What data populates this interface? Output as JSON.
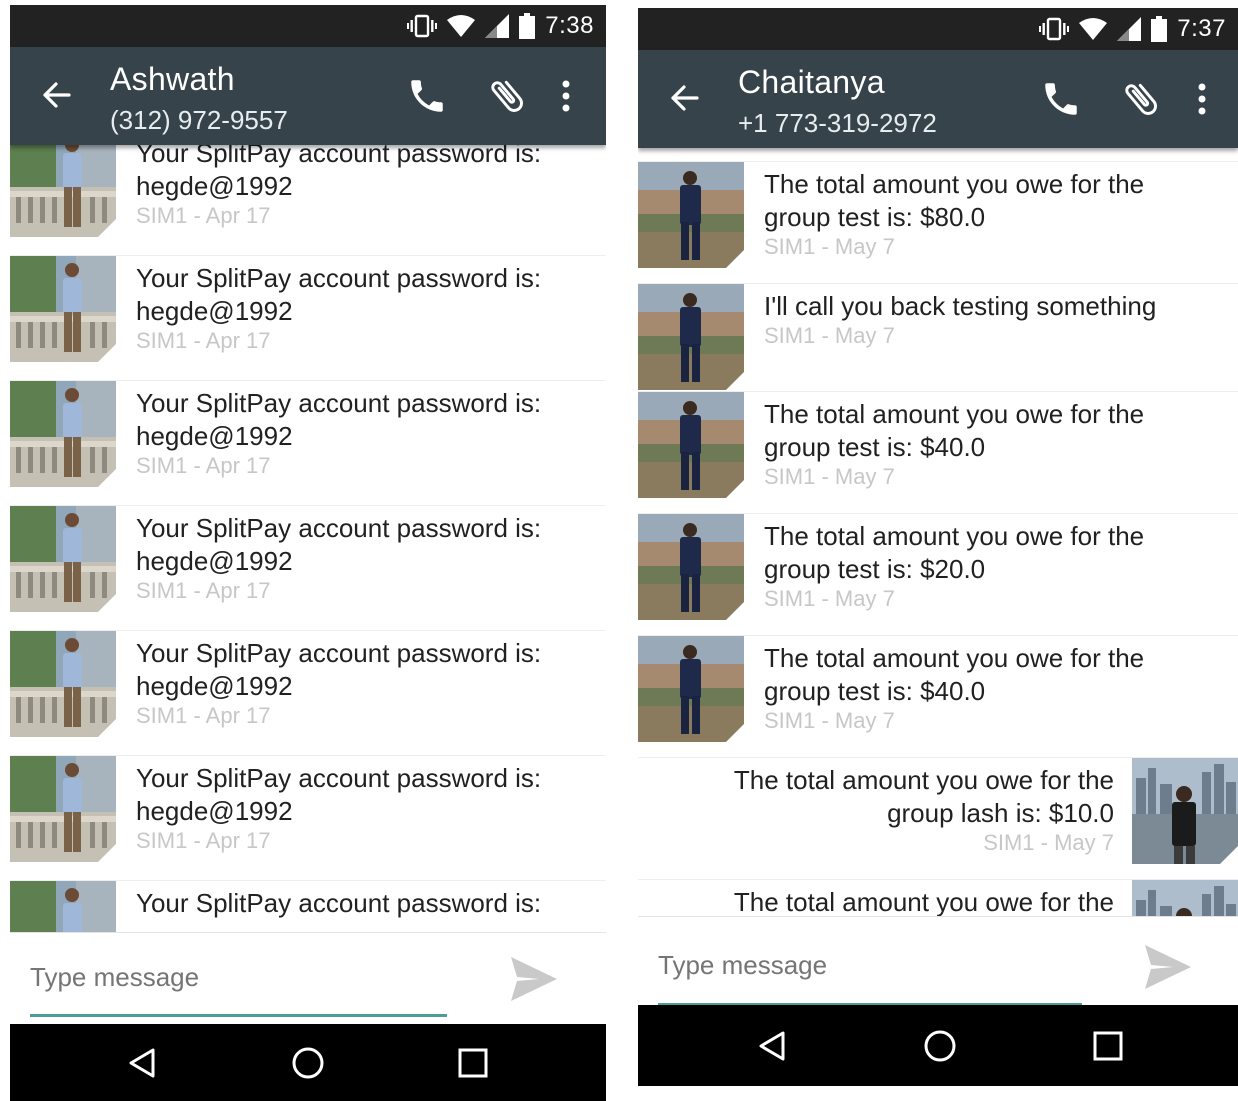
{
  "left": {
    "status": {
      "time": "7:38"
    },
    "header": {
      "name": "Ashwath",
      "phone": "(312) 972-9557"
    },
    "messages": [
      {
        "line1": "Your SplitPay account password is:",
        "line2": "hegde@1992",
        "meta": "SIM1 - Apr 17"
      },
      {
        "line1": "Your SplitPay account password is:",
        "line2": "hegde@1992",
        "meta": "SIM1 - Apr 17"
      },
      {
        "line1": "Your SplitPay account password is:",
        "line2": "hegde@1992",
        "meta": "SIM1 - Apr 17"
      },
      {
        "line1": "Your SplitPay account password is:",
        "line2": "hegde@1992",
        "meta": "SIM1 - Apr 17"
      },
      {
        "line1": "Your SplitPay account password is:",
        "line2": "hegde@1992",
        "meta": "SIM1 - Apr 17"
      },
      {
        "line1": "Your SplitPay account password is:",
        "line2": "hegde@1992",
        "meta": "SIM1 - Apr 17"
      },
      {
        "line1": "Your SplitPay account password is:",
        "line2": "",
        "meta": ""
      }
    ],
    "composer": {
      "placeholder": "Type message"
    }
  },
  "right": {
    "status": {
      "time": "7:37"
    },
    "header": {
      "name": "Chaitanya",
      "phone": "+1 773-319-2972"
    },
    "messages": [
      {
        "line1": "The total amount you owe for the",
        "line2": "group test is: $80.0",
        "meta": "SIM1 - May 7",
        "direction": "incoming"
      },
      {
        "line1": "I'll call you back testing something",
        "line2": "",
        "meta": "SIM1 - May 7",
        "direction": "incoming"
      },
      {
        "line1": "The total amount you owe for the",
        "line2": "group test is: $40.0",
        "meta": "SIM1 - May 7",
        "direction": "incoming"
      },
      {
        "line1": "The total amount you owe for the",
        "line2": "group test is: $20.0",
        "meta": "SIM1 - May 7",
        "direction": "incoming"
      },
      {
        "line1": "The total amount you owe for the",
        "line2": "group test is: $40.0",
        "meta": "SIM1 - May 7",
        "direction": "incoming"
      },
      {
        "line1": "The total amount you owe for the",
        "line2": "group lash is: $10.0",
        "meta": "SIM1 - May 7",
        "direction": "outgoing"
      },
      {
        "line1": "The total amount you owe for the",
        "line2": "",
        "meta": "",
        "direction": "outgoing"
      }
    ],
    "composer": {
      "placeholder": "Type message"
    }
  },
  "icons": {
    "back": "arrow-back-icon",
    "call": "phone-icon",
    "attach": "paperclip-icon",
    "more": "more-vert-icon",
    "send": "send-icon",
    "nav_back": "nav-back-icon",
    "nav_home": "nav-home-icon",
    "nav_recents": "nav-recents-icon"
  },
  "colors": {
    "status_bar": "#222222",
    "app_bar": "#37434a",
    "accent_line": "#4e9c9a",
    "meta_text": "#c7c7c7",
    "nav_bar": "#000000"
  }
}
